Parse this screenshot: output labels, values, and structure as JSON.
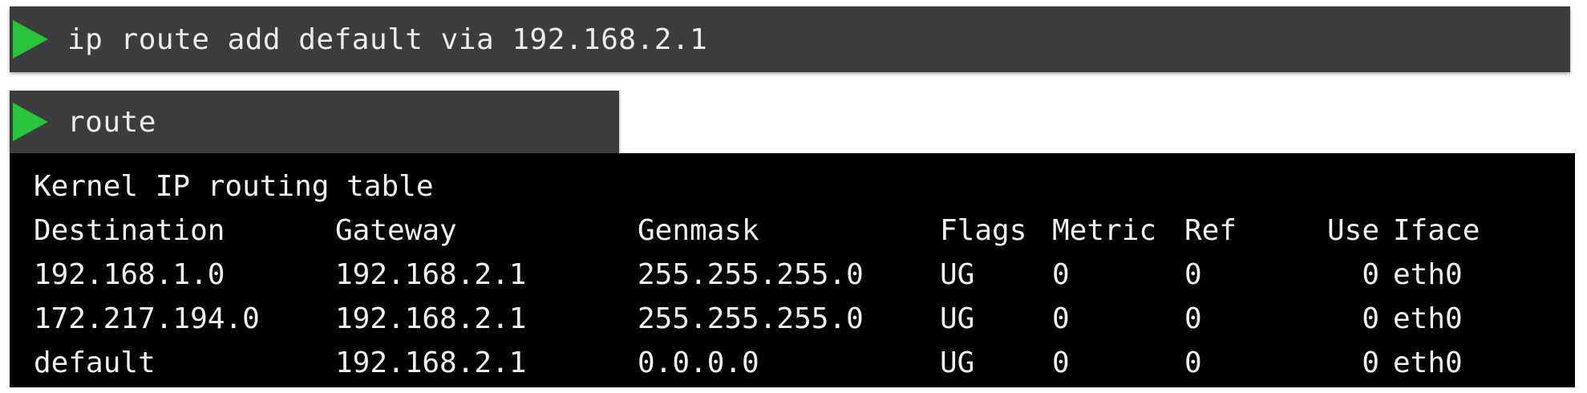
{
  "command_bar_1": {
    "icon": "play-icon",
    "command": "ip route add default via 192.168.2.1"
  },
  "command_bar_2": {
    "icon": "play-icon",
    "command": "route"
  },
  "terminal": {
    "title": "Kernel IP routing table",
    "headers": [
      "Destination",
      "Gateway",
      "Genmask",
      "Flags",
      "Metric",
      "Ref",
      "Use",
      "Iface"
    ],
    "rows": [
      [
        "192.168.1.0",
        "192.168.2.1",
        "255.255.255.0",
        "UG",
        "0",
        "0",
        "0",
        "eth0"
      ],
      [
        "172.217.194.0",
        "192.168.2.1",
        "255.255.255.0",
        "UG",
        "0",
        "0",
        "0",
        "eth0"
      ],
      [
        "default",
        "192.168.2.1",
        "0.0.0.0",
        "UG",
        "0",
        "0",
        "0",
        "eth0"
      ]
    ]
  },
  "colors": {
    "bar_background": "#3c3c3c",
    "play_icon": "#27c53a",
    "terminal_background": "#000000",
    "terminal_text": "#f2f2f2"
  }
}
